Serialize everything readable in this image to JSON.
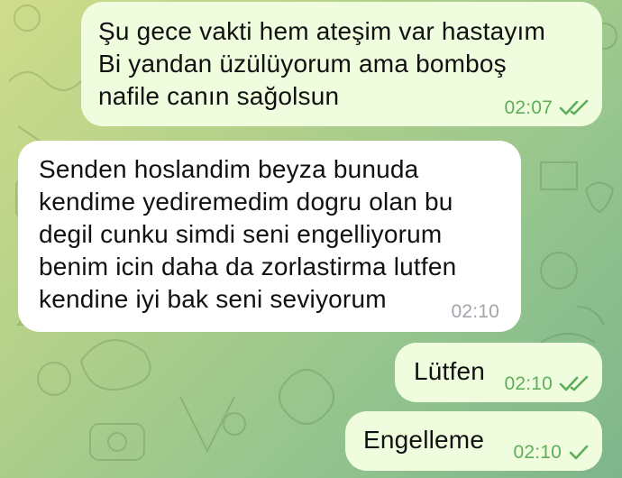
{
  "messages": [
    {
      "direction": "outgoing",
      "lines": [
        "Şu gece vakti hem ateşim var hastayım",
        "Bi yandan üzülüyorum ama bomboş",
        "nafile canın sağolsun"
      ],
      "time": "02:07",
      "status_icon": "double-check-icon"
    },
    {
      "direction": "incoming",
      "lines": [
        "Senden hoslandim beyza bunuda",
        "kendime yediremedim dogru olan bu",
        "degil cunku simdi seni engelliyorum",
        "benim icin daha da zorlastirma lutfen",
        "kendine iyi bak seni seviyorum"
      ],
      "time": "02:10"
    },
    {
      "direction": "outgoing",
      "lines": [
        "Lütfen"
      ],
      "time": "02:10",
      "status_icon": "double-check-icon"
    },
    {
      "direction": "outgoing",
      "lines": [
        "Engelleme"
      ],
      "time": "02:10",
      "status_icon": "single-check-icon"
    }
  ],
  "colors": {
    "outgoing_bubble": "#effdde",
    "incoming_bubble": "#ffffff",
    "outgoing_meta": "#5eae5a",
    "incoming_meta": "#a0a6ab",
    "wallpaper_gradient": [
      "#cfdc8a",
      "#93c48e"
    ]
  }
}
